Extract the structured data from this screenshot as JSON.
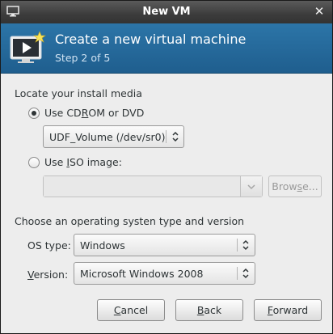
{
  "window": {
    "title": "New VM"
  },
  "header": {
    "title": "Create a new virtual machine",
    "step": "Step 2 of 5"
  },
  "install_media": {
    "section_label": "Locate your install media",
    "cdrom": {
      "label_pre": "Use CD",
      "label_mnemonic": "R",
      "label_post": "OM or DVD",
      "selected": true,
      "device_value": "UDF_Volume (/dev/sr0)"
    },
    "iso": {
      "label_pre": "Use ",
      "label_mnemonic": "I",
      "label_post": "SO image:",
      "selected": false,
      "value": "",
      "browse_pre": "Brow",
      "browse_mnemonic": "s",
      "browse_post": "e..."
    }
  },
  "os": {
    "section_label": "Choose an operating systen type and version",
    "type_label": "OS type:",
    "type_value": "Windows",
    "version_label_pre": "",
    "version_label_mnemonic": "V",
    "version_label_post": "ersion:",
    "version_value": "Microsoft Windows 2008"
  },
  "buttons": {
    "cancel": {
      "mnemonic": "C",
      "rest": "ancel"
    },
    "back": {
      "mnemonic": "B",
      "rest": "ack"
    },
    "forward": {
      "mnemonic": "F",
      "rest": "orward"
    }
  },
  "icons": {
    "window": "monitor-icon",
    "close": "close-icon",
    "header": "vm-screen-new-icon",
    "combo_arrows": "up-down-arrows-icon",
    "dropdown": "chevron-down-icon"
  },
  "colors": {
    "header_bg": "#2c75a8",
    "titlebar_bg": "#3c3c3c",
    "dialog_bg": "#ededed"
  }
}
